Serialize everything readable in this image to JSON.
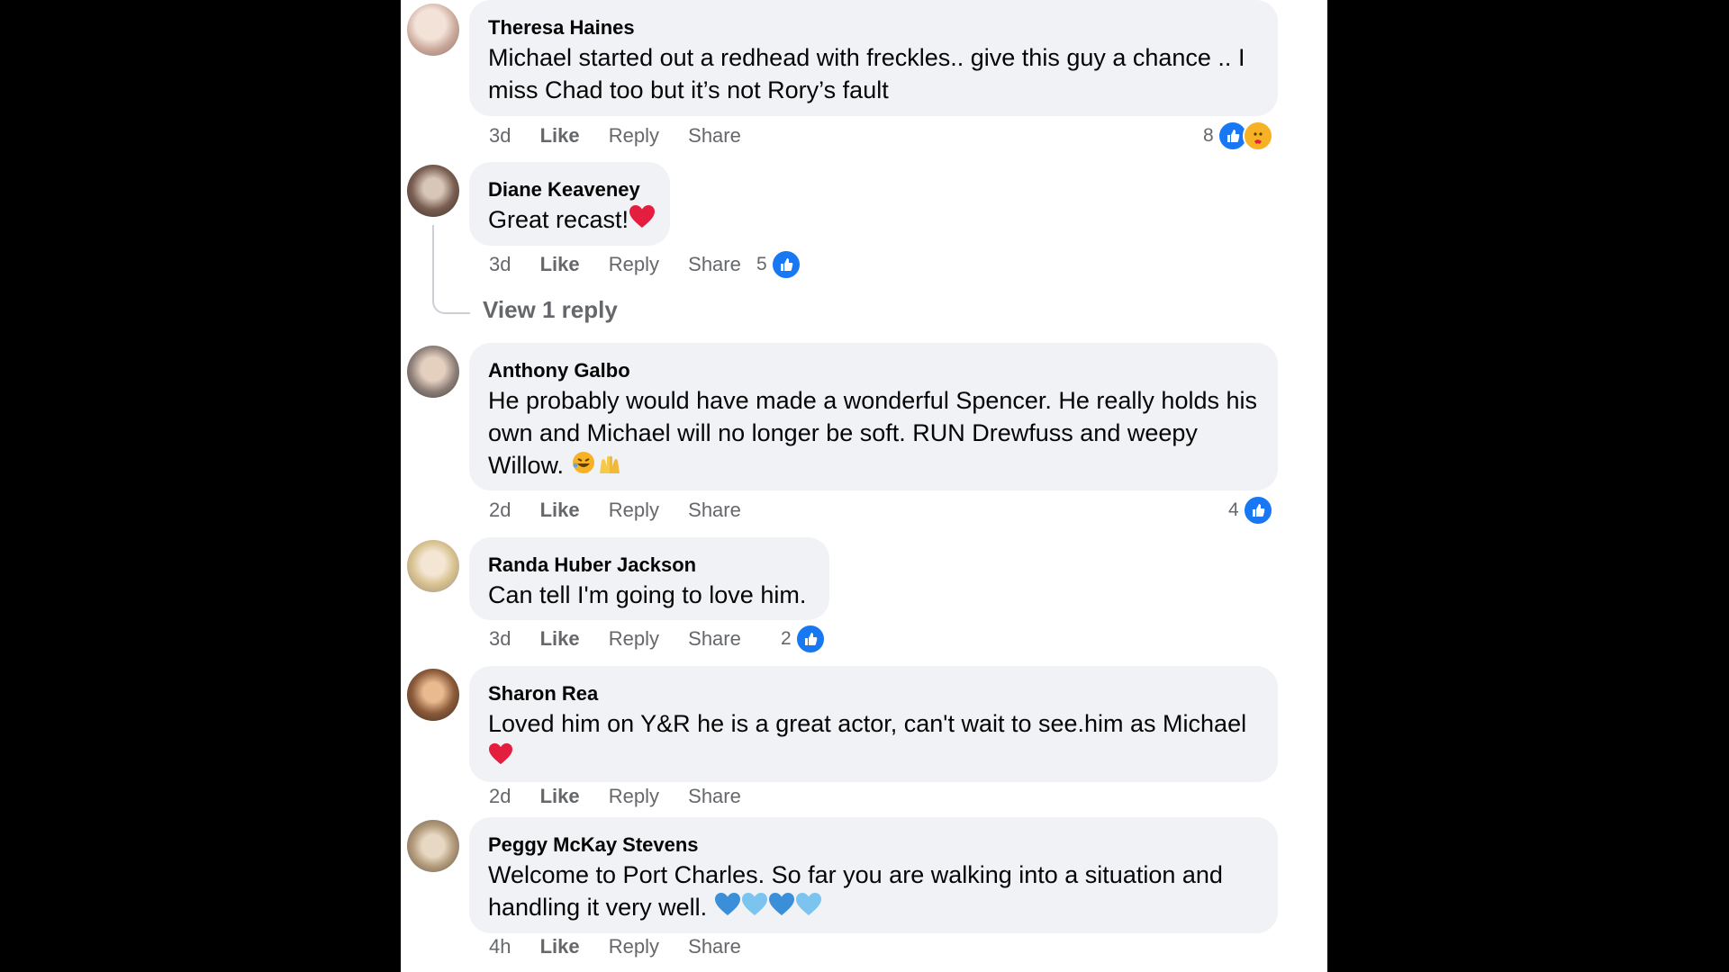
{
  "comments": [
    {
      "author": "Theresa Haines",
      "line1": "Michael started out a redhead with freckles.. give this guy a chance .. I",
      "line2": "miss Chad too but it’s not Rory’s fault",
      "time": "3d",
      "like": "Like",
      "reply": "Reply",
      "share": "Share",
      "reaction_count": "8"
    },
    {
      "author": "Diane Keaveney",
      "line1": "Great recast!",
      "time": "3d",
      "like": "Like",
      "reply": "Reply",
      "share": "Share",
      "reaction_count": "5"
    },
    {
      "author": "Anthony Galbo",
      "line1": "He probably would have made a wonderful Spencer. He really holds his",
      "line2": "own and Michael will no longer be soft. RUN Drewfuss and weepy",
      "line3": "Willow.",
      "time": "2d",
      "like": "Like",
      "reply": "Reply",
      "share": "Share",
      "reaction_count": "4"
    },
    {
      "author": "Randa Huber Jackson",
      "line1": "Can tell I'm going to love him.",
      "time": "3d",
      "like": "Like",
      "reply": "Reply",
      "share": "Share",
      "reaction_count": "2"
    },
    {
      "author": "Sharon Rea",
      "line1": "Loved him on Y&R he is a great actor, can't wait to see.him as Michael",
      "time": "2d",
      "like": "Like",
      "reply": "Reply",
      "share": "Share"
    },
    {
      "author": "Peggy McKay Stevens",
      "line1": "Welcome to Port Charles. So far you are walking into a situation and",
      "line2": "handling it very well.",
      "time": "4h",
      "like": "Like",
      "reply": "Reply",
      "share": "Share"
    }
  ],
  "view_replies": "View 1 reply",
  "colors": {
    "like_blue": "#1877f2",
    "bubble_bg": "#f0f2f5",
    "heart_red": "#e41e3f",
    "heart_blue": "#5aa9e6"
  },
  "icons": [
    "like-icon",
    "care-icon",
    "red-heart-icon",
    "blue-heart-icon",
    "rofl-emoji-icon",
    "raised-hands-emoji-icon"
  ]
}
